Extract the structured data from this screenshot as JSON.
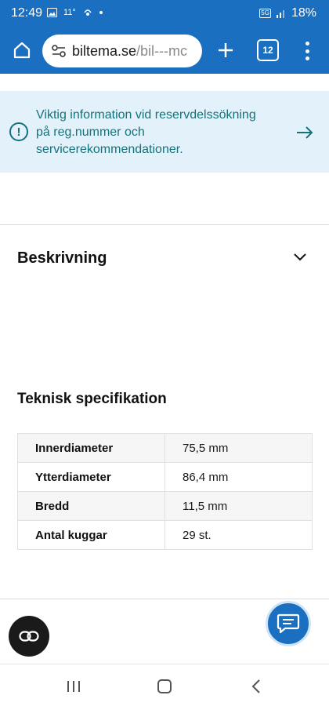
{
  "status_bar": {
    "time": "12:49",
    "temperature": "11°",
    "network": "5G",
    "battery": "18%"
  },
  "browser": {
    "url_domain": "biltema.se",
    "url_path": "/bil---mc",
    "tab_count": "12"
  },
  "banner": {
    "text": "Viktig information vid reservdelssökning på reg.nummer och servicerekommendationer."
  },
  "description_section": {
    "title": "Beskrivning"
  },
  "spec_section": {
    "title": "Teknisk specifikation",
    "rows": [
      {
        "label": "Innerdiameter",
        "value": "75,5 mm"
      },
      {
        "label": "Ytterdiameter",
        "value": "86,4 mm"
      },
      {
        "label": "Bredd",
        "value": "11,5 mm"
      },
      {
        "label": "Antal kuggar",
        "value": "29 st."
      }
    ]
  },
  "colors": {
    "brand_blue": "#1a6fc0",
    "banner_bg": "#e3f2fa",
    "banner_text": "#15727a"
  }
}
